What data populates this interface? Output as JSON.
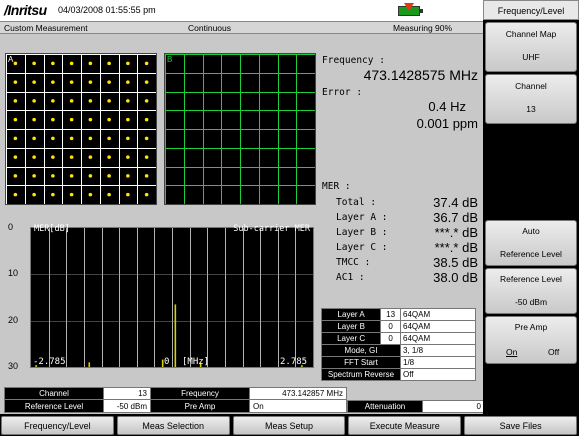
{
  "header": {
    "brand": "/Inritsu",
    "datetime": "04/03/2008 01:55:55 pm",
    "mode": "Custom Measurement",
    "sweep": "Continuous",
    "measuring": "Measuring  90%",
    "battery_color": "#1a9a1a"
  },
  "panels": {
    "a_label": "A",
    "b_label": "B"
  },
  "readout": {
    "frequency_label": "Frequency     :",
    "frequency_value": "473.1428575 MHz",
    "error_label": "Error     :",
    "error_hz": "0.4 Hz",
    "error_ppm": "0.001 ppm",
    "mer_label": "MER :",
    "rows": [
      {
        "label": "Total     :",
        "value": "37.4 dB"
      },
      {
        "label": "Layer A   :",
        "value": "36.7 dB"
      },
      {
        "label": "Layer B   :",
        "value": "***.* dB"
      },
      {
        "label": "Layer C   :",
        "value": "***.* dB"
      },
      {
        "label": "TMCC      :",
        "value": "38.5 dB"
      },
      {
        "label": "AC1       :",
        "value": "38.0 dB"
      }
    ]
  },
  "chart_data": {
    "type": "bar",
    "title": "Sub-carrier MER",
    "ylabel": "MER[dB]",
    "xlabel": "[MHz]",
    "ylim": [
      0,
      30
    ],
    "y_inverted": true,
    "xlim": [
      -2.785,
      2.785
    ],
    "yticks": [
      "0",
      "10",
      "20",
      "30"
    ],
    "xticks": [
      "-2.785",
      "0",
      "2.785"
    ],
    "bar_color": "#d8d000",
    "grid": true,
    "grid_color": "#ffffff",
    "bars": [
      {
        "x": -2.7,
        "value": 29.6
      },
      {
        "x": -1.65,
        "value": 29.0
      },
      {
        "x": -0.2,
        "value": 28.4
      },
      {
        "x": 0.05,
        "value": 16.5
      },
      {
        "x": 0.55,
        "value": 29.1
      },
      {
        "x": 2.55,
        "value": 29.6
      }
    ]
  },
  "layer_table": {
    "rows": [
      {
        "name": "Layer A",
        "segments": "13",
        "mod": "64QAM"
      },
      {
        "name": "Layer B",
        "segments": "0",
        "mod": "64QAM"
      },
      {
        "name": "Layer C",
        "segments": "0",
        "mod": "64QAM"
      }
    ],
    "mode_gi_label": "Mode, GI",
    "mode_gi_value": "3, 1/8",
    "fft_label": "FFT Start",
    "fft_value": "1/8",
    "spectrum_label": "Spectrum Reverse",
    "spectrum_value": "Off"
  },
  "info_bar": {
    "channel_label": "Channel",
    "channel_value": "13",
    "frequency_label": "Frequency",
    "frequency_value": "473.142857 MHz",
    "ref_label": "Reference Level",
    "ref_value": "-50 dBm",
    "preamp_label": "Pre Amp",
    "preamp_value": "On",
    "atten_label": "Attenuation",
    "atten_value": "0 dB"
  },
  "softkeys": {
    "title": "Frequency/Level",
    "channel_map_label": "Channel Map",
    "channel_map_value": "UHF",
    "channel_label": "Channel",
    "channel_value": "13",
    "auto_ref_line1": "Auto",
    "auto_ref_line2": "Reference Level",
    "ref_label": "Reference Level",
    "ref_value": "-50 dBm",
    "preamp_label": "Pre Amp",
    "preamp_on": "On",
    "preamp_off": "Off"
  },
  "bottom_menu": [
    "Frequency/Level",
    "Meas Selection",
    "Meas Setup",
    "Execute Measure",
    "Save Files"
  ]
}
